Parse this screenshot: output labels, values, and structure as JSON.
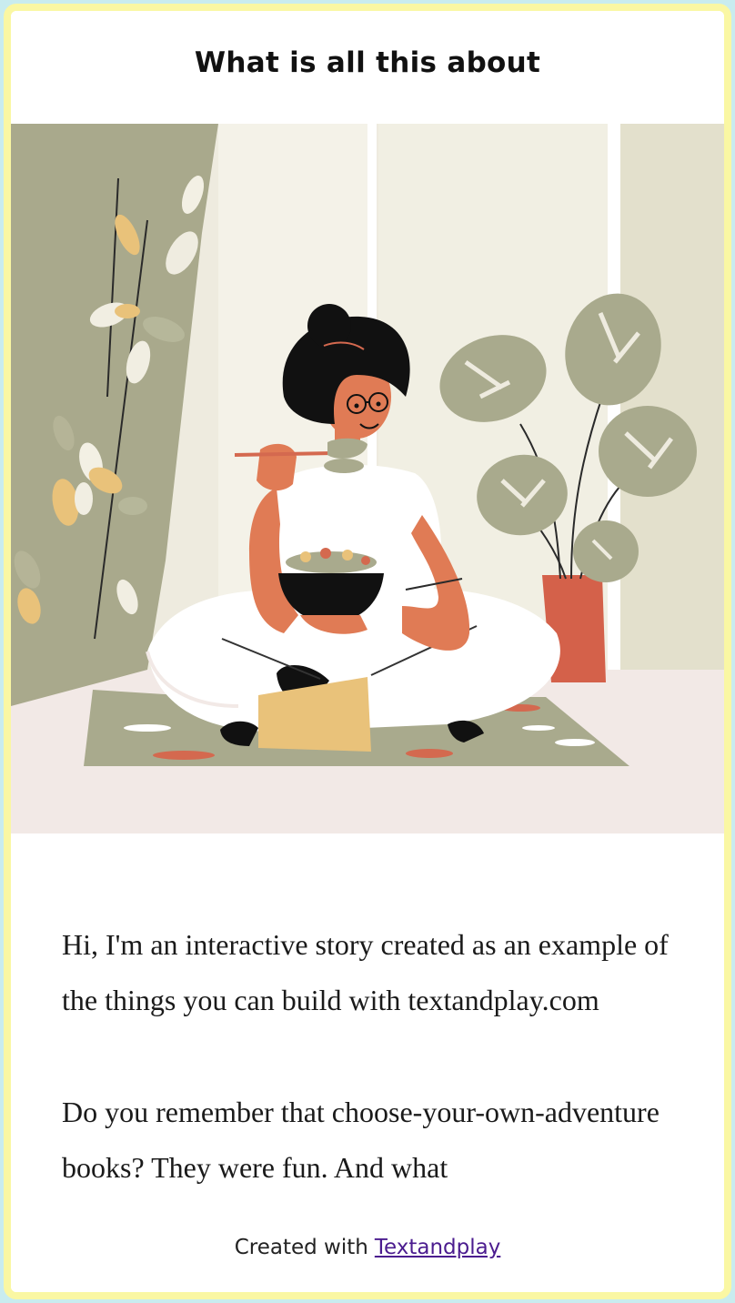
{
  "page": {
    "title": "What is all this about"
  },
  "illustration": {
    "subject": "woman-eating-salad-illustration"
  },
  "story": {
    "paragraphs": [
      "Hi, I'm an interactive story created as an example of the things you can build with textandplay.com",
      "Do you remember that choose-your-own-adventure books? They were fun. And what"
    ]
  },
  "footer": {
    "prefix": "Created with",
    "link_label": "Textandplay"
  },
  "colors": {
    "frame_border": "#faf7a3",
    "link": "#4b1c8f"
  }
}
